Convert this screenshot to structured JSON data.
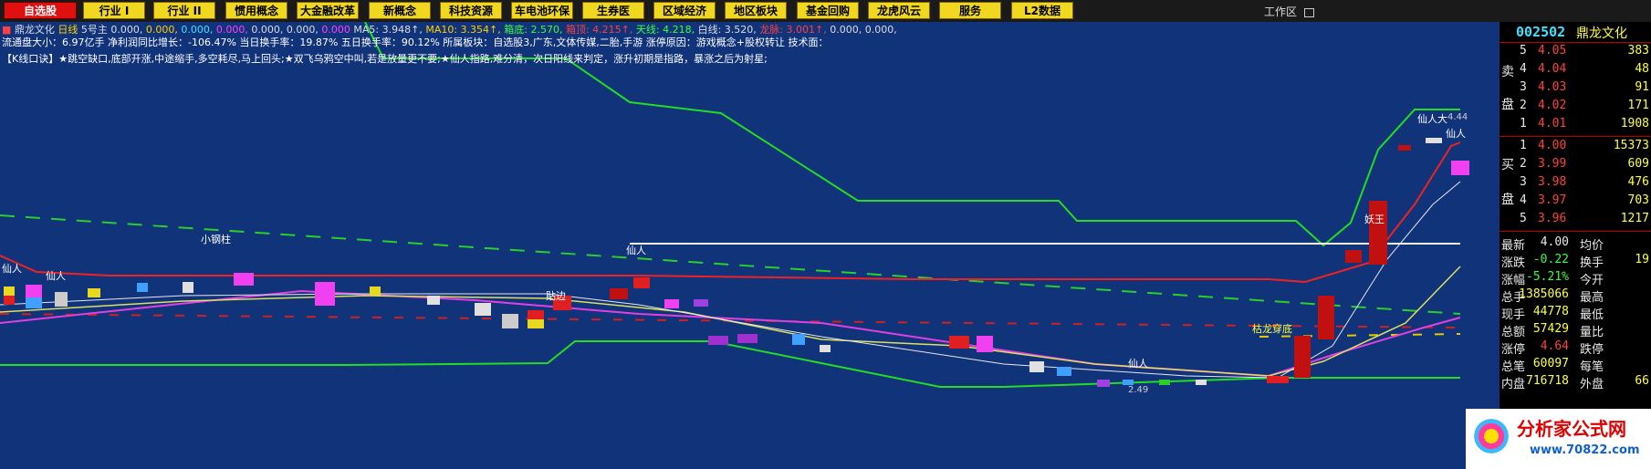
{
  "toolbar": {
    "tabs": [
      {
        "label": "自选股",
        "active": true
      },
      {
        "label": "行业 I",
        "active": false
      },
      {
        "label": "行业 II",
        "active": false
      },
      {
        "label": "惯用概念",
        "active": false
      },
      {
        "label": "大金融改革",
        "active": false
      },
      {
        "label": "新概念",
        "active": false
      },
      {
        "label": "科技资源",
        "active": false
      },
      {
        "label": "车电池环保",
        "active": false
      },
      {
        "label": "生券医",
        "active": false
      },
      {
        "label": "区域经济",
        "active": false
      },
      {
        "label": "地区板块",
        "active": false
      },
      {
        "label": "基金回购",
        "active": false
      },
      {
        "label": "龙虎风云",
        "active": false
      },
      {
        "label": "服务",
        "active": false
      },
      {
        "label": "L2数据",
        "active": false
      }
    ],
    "workarea": "工作区"
  },
  "indicator_line": {
    "stock": "鼎龙文化",
    "period": "日线",
    "label": "5号主",
    "v1": "0.000,",
    "v2": "0.000,",
    "v3": "0.000,",
    "v4": "0.000,",
    "v5": "0.000,",
    "v6": "0.000,",
    "v7": "0.000",
    "ma5": "MA5: 3.948↑,",
    "ma10": "MA10: 3.354↑,",
    "xiangdi": "箱底: 2.570,",
    "xiangding": "箱顶: 4.215↑,",
    "tianxian": "天线: 4.218,",
    "baixian": "白线: 3.520,",
    "longmai": "龙脉: 3.001↑,",
    "v8": "0.000,",
    "v9": "0.000,"
  },
  "info_line2": "流通盘大小：6.97亿手 净利润同比增长：-106.47% 当日换手率：19.87% 五日换手率：90.12% 所属板块：自选股3,广东,文体传媒,二胎,手游 涨停原因：游戏概念+股权转让 技术面：",
  "info_line3": "【K线口诀】★跳空缺口,底部开涨,中途缩手,多空耗尽,马上回头;★双飞乌鸦空中叫,若是放量更不要;★仙人指路,难分清，次日阳线来判定，涨升初期是指路，暴涨之后为射星;",
  "chart_labels": {
    "xiaogangzhu": "小钢柱",
    "xianren1": "仙人",
    "xianren2": "仙人",
    "xianren3": "仙人",
    "xianren4": "仙人",
    "xianren5": "仙人",
    "xianren_da": "仙人大",
    "high_val": "4.44",
    "low_val": "2.49",
    "tietu": "贴边",
    "yaowang": "妖王",
    "kulong": "枯龙穿底"
  },
  "quote": {
    "code": "002502",
    "name": "鼎龙文化",
    "sell_label_1": "卖",
    "sell_label_2": "盘",
    "buy_label_1": "买",
    "buy_label_2": "盘",
    "sell": [
      {
        "lvl": "5",
        "price": "4.05",
        "vol": "383"
      },
      {
        "lvl": "4",
        "price": "4.04",
        "vol": "48"
      },
      {
        "lvl": "3",
        "price": "4.03",
        "vol": "91"
      },
      {
        "lvl": "2",
        "price": "4.02",
        "vol": "171"
      },
      {
        "lvl": "1",
        "price": "4.01",
        "vol": "1908"
      }
    ],
    "buy": [
      {
        "lvl": "1",
        "price": "4.00",
        "vol": "15373"
      },
      {
        "lvl": "2",
        "price": "3.99",
        "vol": "609"
      },
      {
        "lvl": "3",
        "price": "3.98",
        "vol": "476"
      },
      {
        "lvl": "4",
        "price": "3.97",
        "vol": "703"
      },
      {
        "lvl": "5",
        "price": "3.96",
        "vol": "1217"
      }
    ],
    "stats": [
      {
        "l1": "最新",
        "v1": "4.00",
        "l2": "均价",
        "v2": "",
        "c1": "wh"
      },
      {
        "l1": "涨跌",
        "v1": "-0.22",
        "l2": "换手",
        "v2": "19",
        "c1": "dn"
      },
      {
        "l1": "涨幅",
        "v1": "-5.21%",
        "l2": "今开",
        "v2": "",
        "c1": "dn"
      },
      {
        "l1": "总手",
        "v1": "1385066",
        "l2": "最高",
        "v2": "",
        "c1": "wh"
      },
      {
        "l1": "现手",
        "v1": "44778",
        "l2": "最低",
        "v2": "",
        "c1": "wh"
      },
      {
        "l1": "总额",
        "v1": "57429",
        "l2": "量比",
        "v2": "",
        "c1": "wh"
      },
      {
        "l1": "涨停",
        "v1": "4.64",
        "l2": "跌停",
        "v2": "",
        "c1": "up"
      },
      {
        "l1": "总笔",
        "v1": "60097",
        "l2": "每笔",
        "v2": "",
        "c1": "wh"
      },
      {
        "l1": "内盘",
        "v1": "716718",
        "l2": "外盘",
        "v2": "66",
        "c1": "dn"
      }
    ]
  },
  "logo": {
    "text": "分析家公式网",
    "url": "www.70822.com"
  }
}
